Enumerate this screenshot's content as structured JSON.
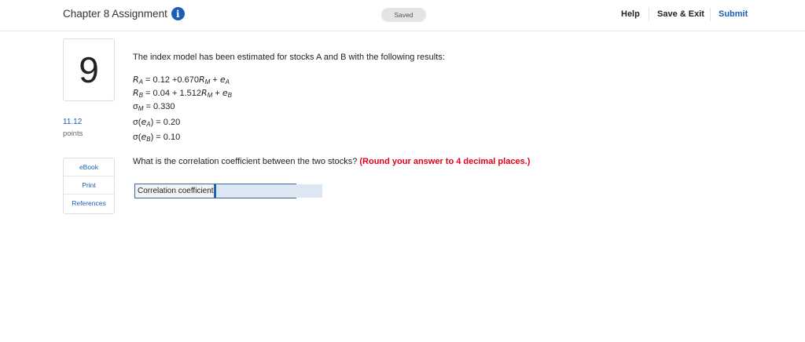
{
  "header": {
    "title": "Chapter 8 Assignment",
    "info_glyph": "i",
    "status": "Saved",
    "help": "Help",
    "save_exit": "Save & Exit",
    "submit": "Submit"
  },
  "question": {
    "number": "9",
    "points_value": "11.12",
    "points_label": "points",
    "intro": "The index model has been estimated for stocks A and B with the following results:",
    "equations": {
      "ra_lhs": "R",
      "ra_sub": "A",
      "ra_mid": " = 0.12 +0.670",
      "ra_rm": "R",
      "ra_rm_sub": "M",
      "ra_plus": " + ",
      "ra_e": "e",
      "ra_e_sub": "A",
      "rb_lhs": "R",
      "rb_sub": "B",
      "rb_mid": " = 0.04 + 1.512",
      "rb_rm": "R",
      "rb_rm_sub": "M",
      "rb_plus": " + ",
      "rb_e": "e",
      "rb_e_sub": "B",
      "sm_sigma": "σ",
      "sm_sub": "M",
      "sm_val": " = 0.330",
      "sea_open": "σ(",
      "sea_e": "e",
      "sea_sub": "A",
      "sea_val": ") = 0.20",
      "seb_open": "σ(",
      "seb_e": "e",
      "seb_sub": "B",
      "seb_val": ") = 0.10"
    },
    "prompt": "What is the correlation coefficient between the two stocks? ",
    "instruction": "(Round your answer to 4 decimal places.)",
    "answer_label": "Correlation coefficient",
    "answer_value": ""
  },
  "resources": {
    "ebook": "eBook",
    "print": "Print",
    "references": "References"
  },
  "colors": {
    "accent": "#1a5fb4",
    "instruction_red": "#e0001b"
  }
}
